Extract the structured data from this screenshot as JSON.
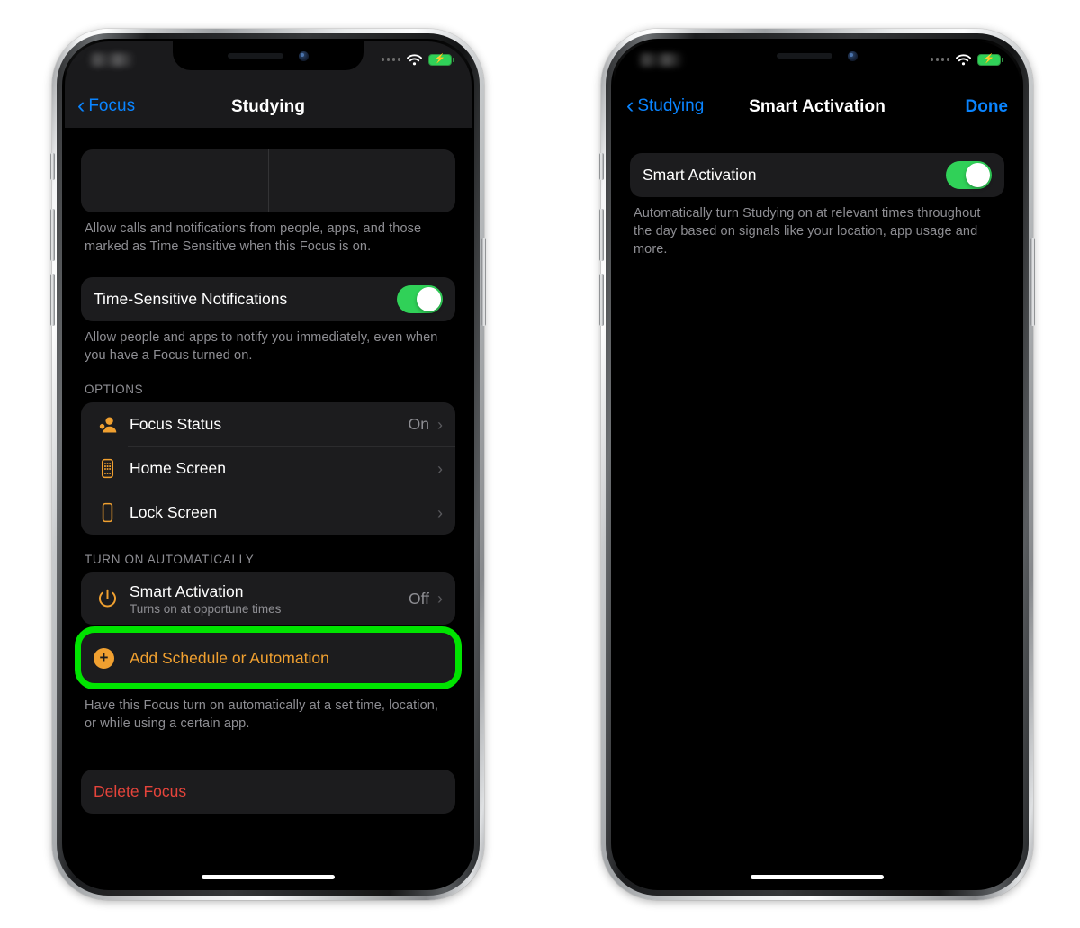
{
  "meta": {
    "accent_blue": "#0a84ff",
    "accent_orange": "#f0a030",
    "toggle_green": "#30d158",
    "highlight_green": "#00e400",
    "destructive_red": "#e5443b"
  },
  "phone_left": {
    "status": {
      "signal_icon": "signal-dots",
      "wifi_icon": "wifi-icon",
      "battery_icon": "battery-charging-icon",
      "battery_bolt": "⚡"
    },
    "nav": {
      "back_label": "Focus",
      "back_icon": "chevron-left-icon",
      "title": "Studying"
    },
    "footnote_1": "Allow calls and notifications from people, apps, and those marked as Time Sensitive when this Focus is on.",
    "time_sensitive": {
      "label": "Time-Sensitive Notifications",
      "toggle_state": "on"
    },
    "footnote_2": "Allow people and apps to notify you immediately, even when you have a Focus turned on.",
    "options_header": "OPTIONS",
    "options_rows": [
      {
        "icon": "focus-status-icon",
        "label": "Focus Status",
        "value": "On",
        "chevron": "›"
      },
      {
        "icon": "home-screen-icon",
        "label": "Home Screen",
        "value": "",
        "chevron": "›"
      },
      {
        "icon": "lock-screen-icon",
        "label": "Lock Screen",
        "value": "",
        "chevron": "›"
      }
    ],
    "turn_on_header": "TURN ON AUTOMATICALLY",
    "smart_activation": {
      "icon": "power-icon",
      "label": "Smart Activation",
      "sublabel": "Turns on at opportune times",
      "value": "Off",
      "chevron": "›"
    },
    "add_schedule": {
      "icon": "plus-circle-icon",
      "label": "Add Schedule or Automation",
      "highlighted": true
    },
    "footnote_3": "Have this Focus turn on automatically at a set time, location, or while using a certain app.",
    "delete_focus": {
      "label": "Delete Focus"
    }
  },
  "phone_right": {
    "status": {
      "signal_icon": "signal-dots",
      "wifi_icon": "wifi-icon",
      "battery_icon": "battery-charging-icon",
      "battery_bolt": "⚡"
    },
    "nav": {
      "back_label": "Studying",
      "back_icon": "chevron-left-icon",
      "title": "Smart Activation",
      "done_label": "Done"
    },
    "smart_activation": {
      "label": "Smart Activation",
      "toggle_state": "on"
    },
    "footnote": "Automatically turn Studying on at relevant times throughout the day based on signals like your location, app usage and more."
  }
}
